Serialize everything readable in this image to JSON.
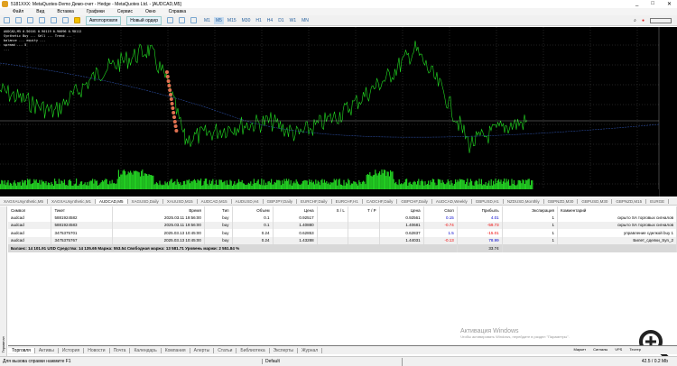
{
  "window": {
    "title": "5181XXX: MetaQuotes-Demo Демо-счет - Hedge - MetaQuotes Ltd. - [AUDCAD,M5]",
    "controls": [
      "_",
      "□",
      "✕"
    ]
  },
  "menu": [
    "Файл",
    "Вид",
    "Вставка",
    "Графики",
    "Сервис",
    "Окно",
    "Справка"
  ],
  "toolbar": {
    "autotrade": "Автоторговля",
    "new_order": "Новый ордер",
    "timeframes": [
      "M1",
      "M5",
      "M15",
      "M30",
      "H1",
      "H4",
      "D1",
      "W1",
      "MN"
    ],
    "active_timeframe": "M5"
  },
  "chart": {
    "info_lines": [
      "AUDCAD,M5  0.90101 0.90119 0.90096 0.90112",
      "Synthetic Buy ... Sell ... Trend ...",
      "balance ... equity ...",
      "spread ... 5",
      "..."
    ],
    "price_color": "#22dd22",
    "background": "#000000"
  },
  "symbol_tabs": [
    "XAGXAUsynthetic,M5",
    "XAGXAUsynthetic,M1",
    "AUDCAD,M5",
    "XAGUSD,Daily",
    "XAUUSD,M15",
    "AUDCAD,M15",
    "AUDUSD,H4",
    "GBPJPY,Daily",
    "EURCHF,Daily",
    "EURCHF,H1",
    "CADCHF,Daily",
    "GBPCHF,Daily",
    "AUDCAD,Weekly",
    "GBPUSD,H1",
    "NZDUSD,Monthly",
    "GBPNZD,M30",
    "GBPUSD,M30",
    "GBPNZD,M15",
    "EURGE"
  ],
  "active_symbol_tab": "AUDCAD,M5",
  "orders": {
    "headers": [
      "Символ",
      "Тикет",
      "Время",
      "Тип",
      "Объем",
      "Цена",
      "S / L",
      "T / P",
      "Цена",
      "Своп",
      "Прибыль",
      "Экспирация",
      "Комментарий"
    ],
    "rows": [
      [
        "audcad",
        "5881924582",
        "2025.03.11 19:56:00",
        "buy",
        "0.1",
        "0.92517",
        "",
        "",
        "0.92561",
        "0.15",
        "4.01",
        "1",
        "скрыто SA торговых сигналов"
      ],
      [
        "audcad",
        "5881924583",
        "2025.03.11 19:56:00",
        "buy",
        "0.1",
        "1.40880",
        "",
        "",
        "1.40681",
        "-0.74",
        "-59.73",
        "1",
        "скрыто SA торговых сигналов"
      ],
      [
        "audcad",
        "3475375701",
        "2025.03.13 10:45:00",
        "buy",
        "0.24",
        "0.62853",
        "",
        "",
        "0.62837",
        "1.5",
        "-15.01",
        "1",
        "управление сделкой buy 1"
      ],
      [
        "audcad",
        "3475375767",
        "2025.03.13 10:45:00",
        "buy",
        "0.24",
        "1.43288",
        "",
        "",
        "1.44031",
        "-0.13",
        "78.99",
        "1",
        "Билет_сделки_Syn_2"
      ]
    ],
    "balance_line": "Баланс: 14 101.91 USD  Средства: 14 135.65  Маржа: 553.54  Свободная маржа: 13 581.71  Уровень маржи: 2 551.84 %",
    "total_profit": "33.74"
  },
  "terminal_label": "Терминал",
  "bottom_tabs": [
    "Торговля",
    "Активы",
    "История",
    "Новости",
    "Почта",
    "Календарь",
    "Компания",
    "Алерты",
    "Статьи",
    "Библиотека",
    "Эксперты",
    "Журнал"
  ],
  "active_bottom_tab": "Торговля",
  "right_links": [
    "Маркет",
    "Сигналы",
    "VPS",
    "Тестер"
  ],
  "watermark": {
    "title": "Активация Windows",
    "text": "Чтобы активировать Windows, перейдите в раздел \"Параметры\"."
  },
  "status": {
    "help": "Для вызова справки нажмите F1",
    "profile": "Default",
    "traffic": "42.5 / 0.2 Mb"
  }
}
